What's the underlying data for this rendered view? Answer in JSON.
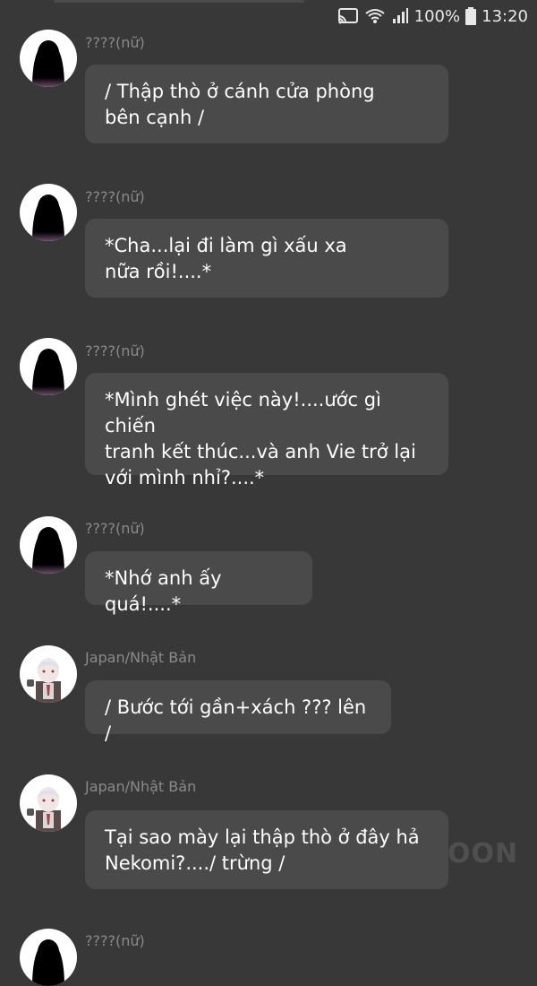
{
  "status_bar": {
    "battery": "100%",
    "time": "13:20",
    "icons": [
      "cast-icon",
      "wifi-icon",
      "signal-icon",
      "battery-icon"
    ]
  },
  "messages": [
    {
      "sender": "????(nữ)",
      "avatar": "silhouette",
      "text": "/ Thập thò ở cánh cửa phòng\nbên cạnh /"
    },
    {
      "sender": "????(nữ)",
      "avatar": "silhouette",
      "text": "*Cha...lại đi làm gì xấu xa\nnữa rồi!....*"
    },
    {
      "sender": "????(nữ)",
      "avatar": "silhouette",
      "text": "*Mình ghét việc này!....ước gì chiến\ntranh kết thúc...và anh Vie trở lại\nvới mình nhỉ?....*"
    },
    {
      "sender": "????(nữ)",
      "avatar": "silhouette",
      "text": "*Nhớ anh ấy quá!....*"
    },
    {
      "sender": "Japan/Nhật Bản",
      "avatar": "japan",
      "text": "/ Bước tới gần+xách ??? lên /"
    },
    {
      "sender": "Japan/Nhật Bản",
      "avatar": "japan",
      "text": "Tại sao mày lại thập thò ở đây hả\nNekomi?..../ trừng /"
    },
    {
      "sender": "????(nữ)",
      "avatar": "silhouette",
      "text": ""
    }
  ],
  "watermark": "OON",
  "colors": {
    "background": "#383838",
    "bubble": "#4a4a4a",
    "sender_text": "#8a8a8a",
    "message_text": "#ffffff"
  }
}
